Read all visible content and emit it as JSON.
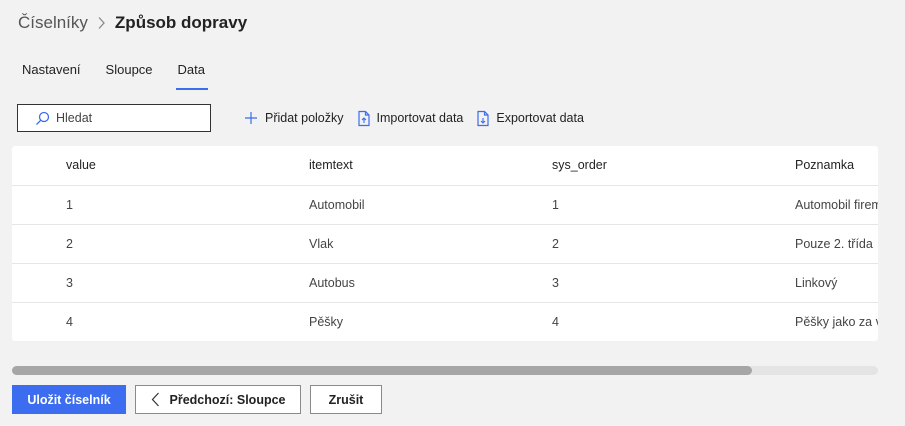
{
  "breadcrumb": {
    "parent": "Číselníky",
    "current": "Způsob dopravy"
  },
  "tabs": [
    {
      "label": "Nastavení",
      "active": false
    },
    {
      "label": "Sloupce",
      "active": false
    },
    {
      "label": "Data",
      "active": true
    }
  ],
  "search": {
    "placeholder": "Hledat",
    "value": ""
  },
  "toolbar": {
    "add_label": "Přidat položky",
    "import_label": "Importovat data",
    "export_label": "Exportovat data"
  },
  "table": {
    "columns": [
      "value",
      "itemtext",
      "sys_order",
      "Poznamka"
    ],
    "rows": [
      [
        "1",
        "Automobil",
        "1",
        "Automobil firem"
      ],
      [
        "2",
        "Vlak",
        "2",
        "Pouze 2. třída"
      ],
      [
        "3",
        "Autobus",
        "3",
        "Linkový"
      ],
      [
        "4",
        "Pěšky",
        "4",
        "Pěšky jako za vo"
      ]
    ]
  },
  "scrollbar": {
    "thumb_fraction": 0.855
  },
  "footer": {
    "save_label": "Uložit číselník",
    "prev_label": "Předchozí: Sloupce",
    "cancel_label": "Zrušit"
  },
  "colors": {
    "accent": "#3c6df0",
    "background": "#f2f2f2"
  },
  "icons": {
    "breadcrumb_separator": "chevron-right-icon",
    "search": "search-icon",
    "add": "plus-icon",
    "import": "file-import-icon",
    "export": "file-export-icon",
    "prev": "chevron-left-icon"
  }
}
